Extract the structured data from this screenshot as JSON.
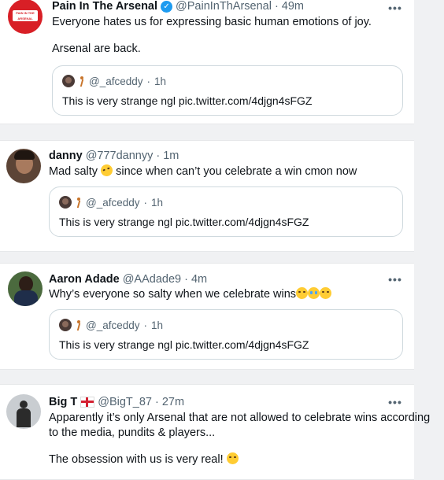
{
  "tweets": [
    {
      "name": "Pain In The Arsenal",
      "handle": "@PainInThArsenal",
      "time": "49m",
      "verified": true,
      "text_lines": [
        "Everyone hates us for expressing basic human emotions of joy.",
        "Arsenal are back."
      ],
      "avatar_text": "PAIN IN THE ARSENAL",
      "quote": {
        "handle": "@_afceddy",
        "time": "1h",
        "text": "This is very strange ngl pic.twitter.com/4djgn4sFGZ"
      }
    },
    {
      "name": "danny",
      "handle": "@777dannyy",
      "time": "1m",
      "text_before": "Mad salty",
      "text_after": "since when can’t you celebrate a win cmon now",
      "quote": {
        "handle": "@_afceddy",
        "time": "1h",
        "text": "This is very strange ngl pic.twitter.com/4djgn4sFGZ"
      }
    },
    {
      "name": "Aaron Adade",
      "handle": "@AAdade9",
      "time": "4m",
      "text": "Why’s everyone so salty when we celebrate wins",
      "quote": {
        "handle": "@_afceddy",
        "time": "1h",
        "text": "This is very strange ngl pic.twitter.com/4djgn4sFGZ"
      }
    },
    {
      "name": "Big T",
      "handle": "@BigT_87",
      "time": "27m",
      "text_lines": [
        "Apparently it’s only Arsenal that are not allowed to celebrate wins according",
        "to the media, pundits & players...",
        "The obsession with us is very real!"
      ]
    }
  ],
  "separator": "·",
  "more_label": "•••",
  "colors": {
    "accent": "#1d9bf0",
    "arsenal_red": "#d81f26"
  }
}
